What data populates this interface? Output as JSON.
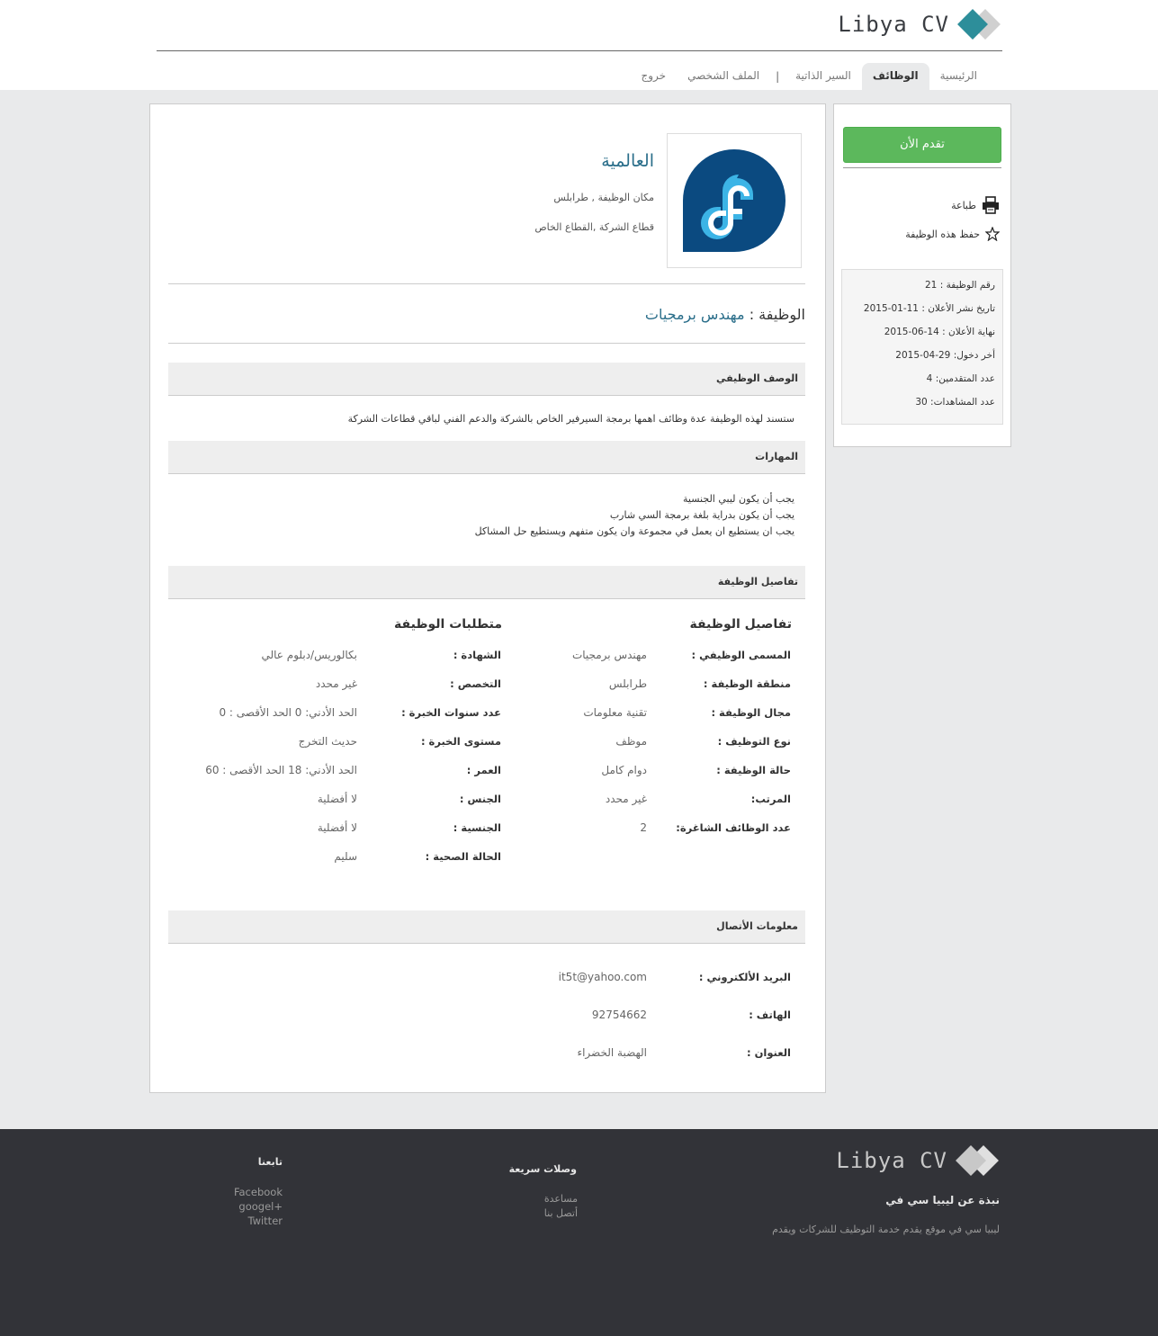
{
  "brand": {
    "name": "Libya CV",
    "accent_color": "#2d8e9a"
  },
  "nav": {
    "items": [
      {
        "label": "الرئيسية",
        "active": false
      },
      {
        "label": "الوظائف",
        "active": true
      },
      {
        "label": "السير الذاتية",
        "active": false
      },
      {
        "separator": "|"
      },
      {
        "label": "الملف الشخصي",
        "active": false
      },
      {
        "label": "خروج",
        "active": false
      }
    ]
  },
  "company": {
    "logo_icon": "fedora-logo-icon",
    "name": "العالمية",
    "location": "مكان الوظيفة , طرابلس",
    "sector": "قطاع الشركة ,القطاع الخاص"
  },
  "job": {
    "title_label": "الوظيفة :",
    "title_value": "مهندس برمجيات"
  },
  "sections": {
    "description_title": "الوصف الوظيفي",
    "description_text": "ستسند لهذه الوظيفة عدة وظائف اهمها برمجة السيرفير الخاص بالشركة والدعم الفني لباقي قطاعات الشركة",
    "skills_title": "المهارات",
    "skills": [
      "يجب أن يكون ليبي الجنسية",
      "يجب أن يكون بدراية بلغة برمجة السي شارب",
      "يجب ان يستطيع ان يعمل في مجموعة وان يكون متفهم ويستطيع حل المشاكل"
    ],
    "details_title": "تفاصيل الوظيفة",
    "contact_title": "معلومات الأتصال"
  },
  "details": {
    "col1_title": "تفاصيل الوظيفة",
    "col1": [
      {
        "label": "المسمى الوظيفي :",
        "value": "مهندس برمجيات"
      },
      {
        "label": "منطقة الوظيفة :",
        "value": "طرابلس"
      },
      {
        "label": "مجال الوظيفة :",
        "value": "تقنية معلومات"
      },
      {
        "label": "نوع التوظيف :",
        "value": "موظف"
      },
      {
        "label": "حالة الوظيفة :",
        "value": "دوام كامل"
      },
      {
        "label": "المرتب:",
        "value": "غير محدد"
      },
      {
        "label": "عدد الوظائف الشاغرة:",
        "value": "2"
      }
    ],
    "col2_title": "متطلبات الوظيفة",
    "col2": [
      {
        "label": "الشهادة :",
        "value": "بكالوريس/دبلوم عالي"
      },
      {
        "label": "التخصص :",
        "value": "غير محدد"
      },
      {
        "label": "عدد سنوات الخبرة :",
        "value": "الحد الأدني: 0 الحد الأقصى : 0"
      },
      {
        "label": "مستوى الخبرة :",
        "value": "حديث التخرج"
      },
      {
        "label": "العمر :",
        "value": "الحد الأدني: 18 الحد الأقصى : 60"
      },
      {
        "label": "الجنس :",
        "value": "لا أفضلية"
      },
      {
        "label": "الجنسية :",
        "value": "لا أفضلية"
      },
      {
        "label": "الحالة الصحية :",
        "value": "سليم"
      }
    ]
  },
  "contact": [
    {
      "label": "البريد الألكتروني :",
      "value": "it5t@yahoo.com"
    },
    {
      "label": "الهاتف :",
      "value": "92754662"
    },
    {
      "label": "العنوان :",
      "value": "الهضبة الخضراء"
    }
  ],
  "sidebar": {
    "apply_label": "تقدم الأن",
    "print_label": "طباعة",
    "print_icon": "printer-icon",
    "save_label": "حفظ هذه الوظيفة",
    "save_icon": "star-icon",
    "info": [
      "رقم الوظيفة : 21",
      "تاريخ نشر الأعلان : 11-01-2015",
      "نهاية الأعلان : 14-06-2015",
      "أخر دخول: 29-04-2015",
      "عدد المتقدمين: 4",
      "عدد المشاهدات: 30"
    ]
  },
  "footer": {
    "brand_name": "Libya CV",
    "about_title": "نبذة عن ليبيا سي في",
    "about_text": "ليبيا سي في موقع يقدم خدمة التوظيف للشركات ويقدم",
    "links_title": "وصلات سريعة",
    "links": [
      "مساعدة",
      "أتصل بنا"
    ],
    "follow_title": "تابعنا",
    "follow": [
      "Facebook",
      "googel+",
      "Twitter"
    ]
  }
}
